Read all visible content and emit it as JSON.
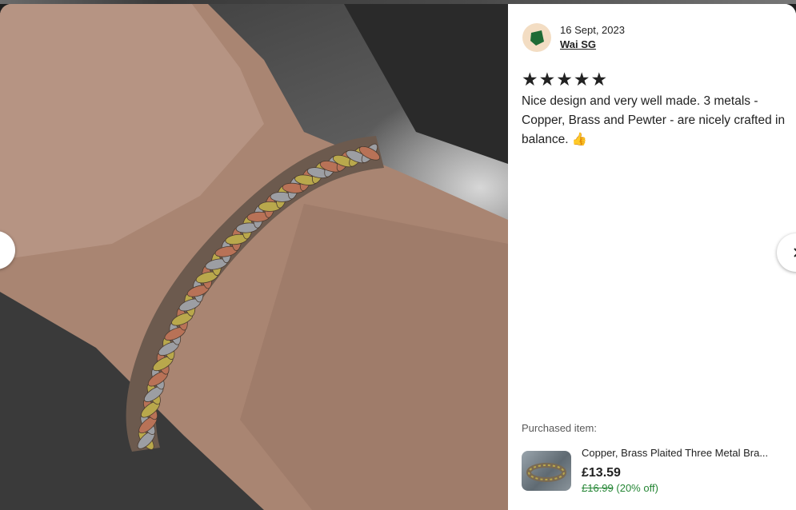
{
  "review": {
    "date": "16 Sept, 2023",
    "reviewer": "Wai SG",
    "rating": 5,
    "rating_max": 5,
    "star_glyph": "★",
    "text": "Nice design and very well made. 3 metals - Copper, Brass and Pewter - are nicely crafted in balance. 👍"
  },
  "purchase": {
    "label": "Purchased item:",
    "title": "Copper, Brass Plaited Three Metal Bra...",
    "price": "£13.59",
    "original_price": "£16.99",
    "discount": "(20% off)"
  },
  "photo": {
    "subject": "braided three-metal bracelet on wrist"
  },
  "nav": {
    "prev_icon": "chevron-left-icon",
    "next_icon": "chevron-right-icon"
  },
  "colors": {
    "avatar_bg": "#f3ddc3",
    "avatar_mark": "#1f6b35",
    "discount_green": "#258635",
    "copper": "#b87257",
    "brass": "#b9a84c",
    "pewter": "#9c9ea3"
  }
}
